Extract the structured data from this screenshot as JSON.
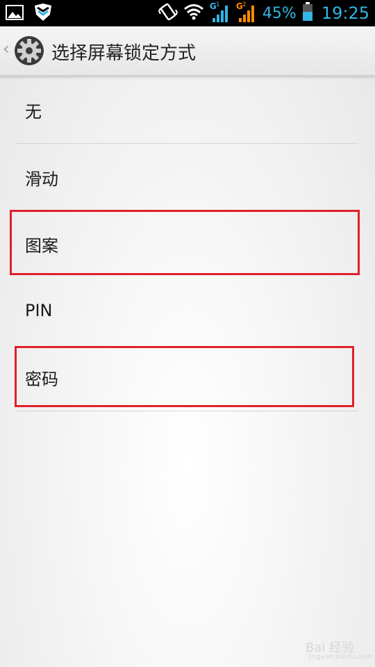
{
  "status_bar": {
    "battery_percent": "45%",
    "time": "19:25",
    "sim1_label": "G",
    "sim1_index": "1",
    "sim2_label": "G",
    "sim2_index": "2",
    "icons": [
      "gallery-icon",
      "shield-icon",
      "vibrate-icon",
      "wifi-icon",
      "signal-icon",
      "signal-icon",
      "battery-icon"
    ],
    "accent_color": "#33b5e5",
    "sim2_color": "#ff8a00"
  },
  "action_bar": {
    "back_glyph": "‹",
    "title": "选择屏幕锁定方式",
    "icon": "settings-gear-icon"
  },
  "options": [
    {
      "label": "无"
    },
    {
      "label": "滑动"
    },
    {
      "label": "图案"
    },
    {
      "label": "PIN"
    },
    {
      "label": "密码"
    }
  ],
  "highlight_color": "#e0202a",
  "watermark": {
    "text": "Bai 经验",
    "sub": "jingyan.baidu.com"
  }
}
